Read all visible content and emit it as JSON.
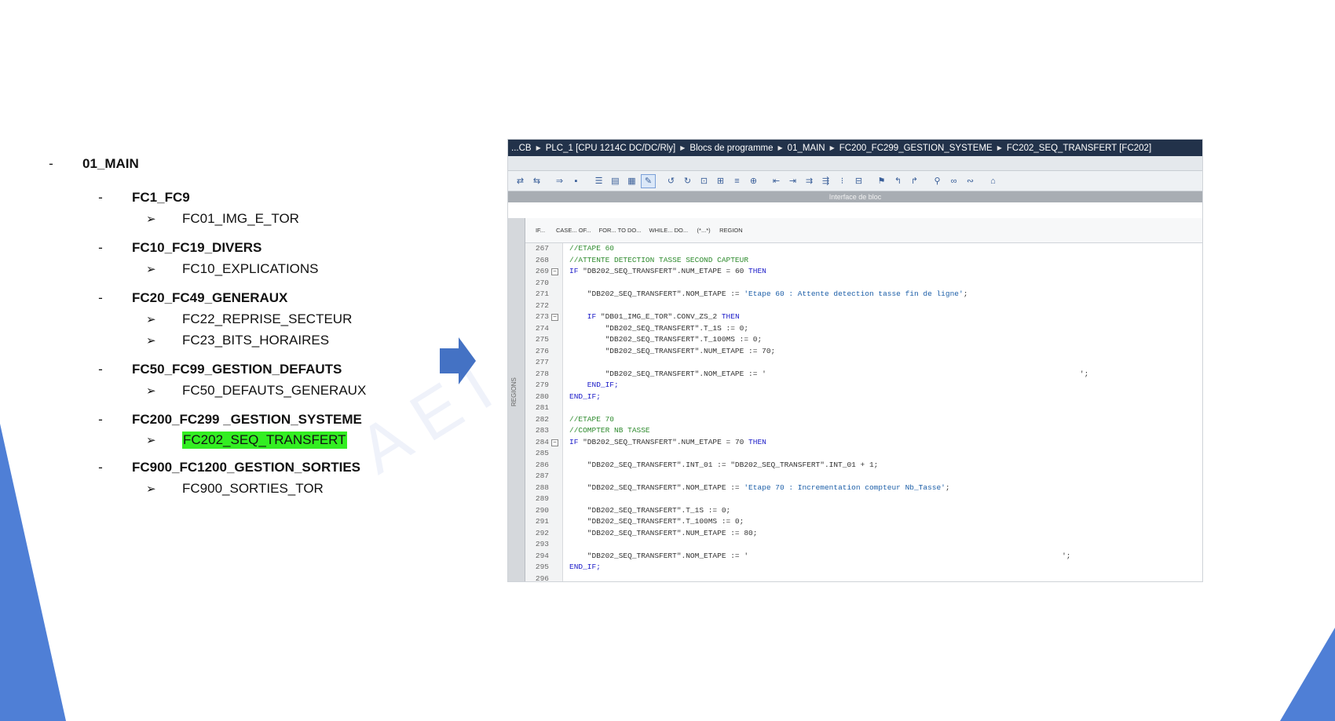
{
  "tree": {
    "root": {
      "dash": "-",
      "label": "01_MAIN"
    },
    "groups": [
      {
        "label": "FC1_FC9",
        "children": [
          "FC01_IMG_E_TOR"
        ]
      },
      {
        "label": "FC10_FC19_DIVERS",
        "children": [
          "FC10_EXPLICATIONS"
        ]
      },
      {
        "label": "FC20_FC49_GENERAUX",
        "children": [
          "FC22_REPRISE_SECTEUR",
          "FC23_BITS_HORAIRES"
        ]
      },
      {
        "label": "FC50_FC99_GESTION_DEFAUTS",
        "children": [
          "FC50_DEFAUTS_GENERAUX"
        ]
      },
      {
        "label": "FC200_FC299 _GESTION_SYSTEME",
        "children": [
          "FC202_SEQ_TRANSFERT"
        ]
      },
      {
        "label": "FC900_FC1200_GESTION_SORTIES",
        "children": [
          "FC900_SORTIES_TOR"
        ]
      }
    ],
    "dash": "-",
    "arrow_glyph": "➢"
  },
  "watermark": "AEI F",
  "colors": {
    "highlight": "#33ee22",
    "arrow": "#4472c4",
    "crumb_bg": "#22324a",
    "comment": "#2e8b2e",
    "keyword": "#1b1bc8"
  },
  "ide": {
    "breadcrumb": [
      "...CB",
      "PLC_1 [CPU 1214C DC/DC/Rly]",
      "Blocs de programme",
      "01_MAIN",
      "FC200_FC299_GESTION_SYSTEME",
      "FC202_SEQ_TRANSFERT [FC202]"
    ],
    "crumb_sep": "▶",
    "interface_label": "Interface de bloc",
    "regions_label": "REGIONS",
    "snippets": [
      "IF...",
      "CASE... OF...",
      "FOR... TO DO...",
      "WHILE... DO...",
      "(*...*)",
      "REGION"
    ],
    "code": [
      {
        "n": "267",
        "parts": [
          {
            "t": "//ETAPE 60",
            "c": "cm"
          }
        ]
      },
      {
        "n": "268",
        "parts": [
          {
            "t": "//ATTENTE DETECTION TASSE SECOND CAPTEUR",
            "c": "cm"
          }
        ]
      },
      {
        "n": "269",
        "fold": true,
        "parts": [
          {
            "t": "IF ",
            "c": "kw"
          },
          {
            "t": "\"DB202_SEQ_TRANSFERT\".NUM_ETAPE = 60 ",
            "c": "tx"
          },
          {
            "t": "THEN",
            "c": "kw"
          }
        ]
      },
      {
        "n": "270",
        "parts": []
      },
      {
        "n": "271",
        "parts": [
          {
            "t": "    \"DB202_SEQ_TRANSFERT\".NOM_ETAPE := ",
            "c": "tx"
          },
          {
            "t": "'Etape 60 : Attente detection tasse fin de ligne'",
            "c": "str"
          },
          {
            "t": ";",
            "c": "tx"
          }
        ]
      },
      {
        "n": "272",
        "parts": []
      },
      {
        "n": "273",
        "fold": true,
        "parts": [
          {
            "t": "    IF ",
            "c": "kw"
          },
          {
            "t": "\"DB01_IMG_E_TOR\".CONV_ZS_2 ",
            "c": "tx"
          },
          {
            "t": "THEN",
            "c": "kw"
          }
        ]
      },
      {
        "n": "274",
        "parts": [
          {
            "t": "        \"DB202_SEQ_TRANSFERT\".T_1S := 0;",
            "c": "tx"
          }
        ]
      },
      {
        "n": "275",
        "parts": [
          {
            "t": "        \"DB202_SEQ_TRANSFERT\".T_100MS := 0;",
            "c": "tx"
          }
        ]
      },
      {
        "n": "276",
        "parts": [
          {
            "t": "        \"DB202_SEQ_TRANSFERT\".NUM_ETAPE := 70;",
            "c": "tx"
          }
        ]
      },
      {
        "n": "277",
        "parts": []
      },
      {
        "n": "278",
        "parts": [
          {
            "t": "        \"DB202_SEQ_TRANSFERT\".NOM_ETAPE := '                                                                      ';",
            "c": "tx"
          }
        ]
      },
      {
        "n": "279",
        "parts": [
          {
            "t": "    END_IF;",
            "c": "kw"
          }
        ]
      },
      {
        "n": "280",
        "parts": [
          {
            "t": "END_IF;",
            "c": "kw"
          }
        ]
      },
      {
        "n": "281",
        "parts": []
      },
      {
        "n": "282",
        "parts": [
          {
            "t": "//ETAPE 70",
            "c": "cm"
          }
        ]
      },
      {
        "n": "283",
        "parts": [
          {
            "t": "//COMPTER NB TASSE",
            "c": "cm"
          }
        ]
      },
      {
        "n": "284",
        "fold": true,
        "parts": [
          {
            "t": "IF ",
            "c": "kw"
          },
          {
            "t": "\"DB202_SEQ_TRANSFERT\".NUM_ETAPE = 70 ",
            "c": "tx"
          },
          {
            "t": "THEN",
            "c": "kw"
          }
        ]
      },
      {
        "n": "285",
        "parts": []
      },
      {
        "n": "286",
        "parts": [
          {
            "t": "    \"DB202_SEQ_TRANSFERT\".INT_01 := \"DB202_SEQ_TRANSFERT\".INT_01 + 1;",
            "c": "tx"
          }
        ]
      },
      {
        "n": "287",
        "parts": []
      },
      {
        "n": "288",
        "parts": [
          {
            "t": "    \"DB202_SEQ_TRANSFERT\".NOM_ETAPE := ",
            "c": "tx"
          },
          {
            "t": "'Etape 70 : Incrementation compteur Nb_Tasse'",
            "c": "str"
          },
          {
            "t": ";",
            "c": "tx"
          }
        ]
      },
      {
        "n": "289",
        "parts": []
      },
      {
        "n": "290",
        "parts": [
          {
            "t": "    \"DB202_SEQ_TRANSFERT\".T_1S := 0;",
            "c": "tx"
          }
        ]
      },
      {
        "n": "291",
        "parts": [
          {
            "t": "    \"DB202_SEQ_TRANSFERT\".T_100MS := 0;",
            "c": "tx"
          }
        ]
      },
      {
        "n": "292",
        "parts": [
          {
            "t": "    \"DB202_SEQ_TRANSFERT\".NUM_ETAPE := 80;",
            "c": "tx"
          }
        ]
      },
      {
        "n": "293",
        "parts": []
      },
      {
        "n": "294",
        "parts": [
          {
            "t": "    \"DB202_SEQ_TRANSFERT\".NOM_ETAPE := '                                                                      ';",
            "c": "tx"
          }
        ]
      },
      {
        "n": "295",
        "parts": [
          {
            "t": "END_IF;",
            "c": "kw"
          }
        ]
      },
      {
        "n": "296",
        "parts": []
      }
    ]
  }
}
